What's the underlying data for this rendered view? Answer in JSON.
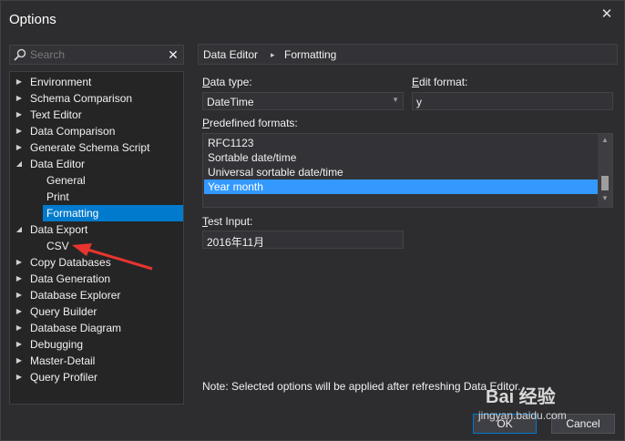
{
  "window": {
    "title": "Options",
    "close_glyph": "✕"
  },
  "search": {
    "placeholder": "Search",
    "clear_glyph": "✕"
  },
  "tree": [
    {
      "label": "Environment",
      "expanded": false,
      "level": 0
    },
    {
      "label": "Schema Comparison",
      "expanded": false,
      "level": 0
    },
    {
      "label": "Text Editor",
      "expanded": false,
      "level": 0
    },
    {
      "label": "Data Comparison",
      "expanded": false,
      "level": 0
    },
    {
      "label": "Generate Schema Script",
      "expanded": false,
      "level": 0
    },
    {
      "label": "Data Editor",
      "expanded": true,
      "level": 0
    },
    {
      "label": "General",
      "level": 1
    },
    {
      "label": "Print",
      "level": 1
    },
    {
      "label": "Formatting",
      "level": 1,
      "selected": true
    },
    {
      "label": "Data Export",
      "expanded": true,
      "level": 0
    },
    {
      "label": "CSV",
      "level": 1
    },
    {
      "label": "Copy Databases",
      "expanded": false,
      "level": 0
    },
    {
      "label": "Data Generation",
      "expanded": false,
      "level": 0
    },
    {
      "label": "Database Explorer",
      "expanded": false,
      "level": 0
    },
    {
      "label": "Query Builder",
      "expanded": false,
      "level": 0
    },
    {
      "label": "Database Diagram",
      "expanded": false,
      "level": 0
    },
    {
      "label": "Debugging",
      "expanded": false,
      "level": 0
    },
    {
      "label": "Master-Detail",
      "expanded": false,
      "level": 0
    },
    {
      "label": "Query Profiler",
      "expanded": false,
      "level": 0
    }
  ],
  "breadcrumb": {
    "first": "Data Editor",
    "separator": "▸",
    "second": "Formatting"
  },
  "form": {
    "data_type_label_key": "D",
    "data_type_label_rest": "ata type:",
    "data_type_value": "DateTime",
    "edit_format_label_key": "E",
    "edit_format_label_rest": "dit format:",
    "edit_format_value": "y",
    "predefined_label_key": "P",
    "predefined_label_rest": "redefined formats:",
    "predefined_items": [
      "RFC1123",
      "Sortable date/time",
      "Universal sortable date/time",
      "Year month"
    ],
    "predefined_selected": "Year month",
    "test_input_label_key": "T",
    "test_input_label_rest": "est Input:",
    "test_input_value": "2016年11月"
  },
  "note": "Note: Selected options will be applied after refreshing Data Editor.",
  "buttons": {
    "ok": "OK",
    "cancel": "Cancel"
  },
  "watermark": {
    "brand": "Bai 经验",
    "url": "jingyan.baidu.com"
  },
  "colors": {
    "selected": "#007acc",
    "list_selected": "#3399ff",
    "annotation_arrow": "#e8342e"
  }
}
